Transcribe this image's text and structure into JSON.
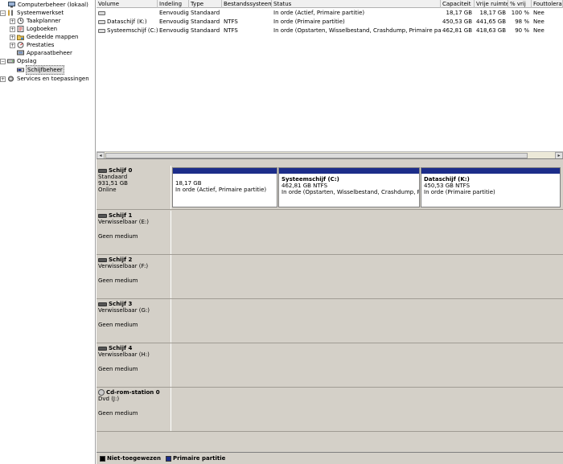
{
  "tree": {
    "items": [
      {
        "label": "Computerbeheer (lokaal)",
        "level": 0,
        "expander": "",
        "icon": "computer-management-icon"
      },
      {
        "label": "Systeemwerkset",
        "level": 1,
        "expander": "−",
        "icon": "system-tools-icon"
      },
      {
        "label": "Taakplanner",
        "level": 2,
        "expander": "+",
        "icon": "task-scheduler-icon"
      },
      {
        "label": "Logboeken",
        "level": 2,
        "expander": "+",
        "icon": "event-viewer-icon"
      },
      {
        "label": "Gedeelde mappen",
        "level": 2,
        "expander": "+",
        "icon": "shared-folders-icon"
      },
      {
        "label": "Prestaties",
        "level": 2,
        "expander": "+",
        "icon": "performance-icon"
      },
      {
        "label": "Apparaatbeheer",
        "level": 2,
        "expander": "",
        "icon": "device-manager-icon"
      },
      {
        "label": "Opslag",
        "level": 1,
        "expander": "−",
        "icon": "storage-icon"
      },
      {
        "label": "Schijfbeheer",
        "level": 2,
        "expander": "",
        "icon": "disk-management-icon",
        "selected": true
      },
      {
        "label": "Services en toepassingen",
        "level": 1,
        "expander": "+",
        "icon": "services-icon"
      }
    ]
  },
  "volumes": {
    "headers": [
      "Volume",
      "Indeling",
      "Type",
      "Bestandssysteem",
      "Status",
      "Capaciteit",
      "Vrije ruimte",
      "% vrij",
      "Fouttolerantie"
    ],
    "rows": [
      [
        "",
        "Eenvoudig",
        "Standaard",
        "",
        "In orde (Actief, Primaire partitie)",
        "18,17 GB",
        "18,17 GB",
        "100 %",
        "Nee"
      ],
      [
        "Dataschijf (K:)",
        "Eenvoudig",
        "Standaard",
        "NTFS",
        "In orde (Primaire partitie)",
        "450,53 GB",
        "441,65 GB",
        "98 %",
        "Nee"
      ],
      [
        "Systeemschijf (C:)",
        "Eenvoudig",
        "Standaard",
        "NTFS",
        "In orde (Opstarten, Wisselbestand, Crashdump, Primaire partitie)",
        "462,81 GB",
        "418,63 GB",
        "90 %",
        "Nee"
      ]
    ],
    "scroll_left": "◂",
    "scroll_right": "▸"
  },
  "disks": [
    {
      "name": "Schijf 0",
      "type": "Standaard",
      "size": "931,51 GB",
      "status": "Online",
      "icon": "disk-icon",
      "partitions": [
        {
          "title": "",
          "size": "18,17 GB",
          "status": "In orde (Actief, Primaire partitie)"
        },
        {
          "title": "Systeemschijf (C:)",
          "size": "462,81 GB NTFS",
          "status": "In orde (Opstarten, Wisselbestand, Crashdump, Prim"
        },
        {
          "title": "Dataschijf (K:)",
          "size": "450,53 GB NTFS",
          "status": "In orde (Primaire partitie)"
        }
      ]
    },
    {
      "name": "Schijf 1",
      "type": "Verwisselbaar (E:)",
      "status": "Geen medium",
      "icon": "removable-disk-icon"
    },
    {
      "name": "Schijf 2",
      "type": "Verwisselbaar (F:)",
      "status": "Geen medium",
      "icon": "removable-disk-icon"
    },
    {
      "name": "Schijf 3",
      "type": "Verwisselbaar (G:)",
      "status": "Geen medium",
      "icon": "removable-disk-icon"
    },
    {
      "name": "Schijf 4",
      "type": "Verwisselbaar (H:)",
      "status": "Geen medium",
      "icon": "removable-disk-icon"
    },
    {
      "name": "Cd-rom-station 0",
      "type": "Dvd (J:)",
      "status": "Geen medium",
      "icon": "cdrom-icon"
    }
  ],
  "legend": [
    {
      "label": "Niet-toegewezen",
      "color": "#000000"
    },
    {
      "label": "Primaire partitie",
      "color": "#1c2d8a"
    }
  ]
}
